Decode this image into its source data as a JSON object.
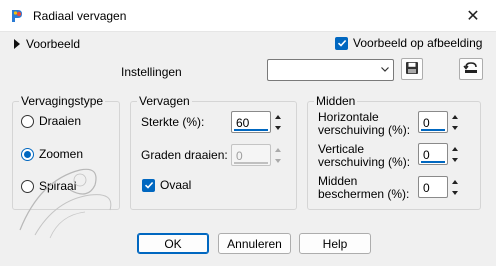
{
  "window": {
    "title": "Radiaal vervagen",
    "close_glyph": "✕"
  },
  "preview": {
    "label": "Voorbeeld",
    "on_image_label": "Voorbeeld op afbeelding",
    "on_image_checked": true
  },
  "settings": {
    "label": "Instellingen",
    "value": ""
  },
  "blur_type": {
    "title": "Vervagingstype",
    "options": [
      {
        "label": "Draaien",
        "selected": false
      },
      {
        "label": "Zoomen",
        "selected": true
      },
      {
        "label": "Spiraal",
        "selected": false
      }
    ]
  },
  "blur": {
    "title": "Vervagen",
    "strength_label": "Sterkte (%):",
    "strength_value": "60",
    "twist_label": "Graden draaien:",
    "twist_value": "0",
    "twist_enabled": false,
    "oval_label": "Ovaal",
    "oval_checked": true
  },
  "center": {
    "title": "Midden",
    "h_offset_label_1": "Horizontale",
    "h_offset_label_2": "verschuiving (%):",
    "h_offset_value": "0",
    "v_offset_label_1": "Verticale",
    "v_offset_label_2": "verschuiving (%):",
    "v_offset_value": "0",
    "protect_label_1": "Midden",
    "protect_label_2": "beschermen (%):",
    "protect_value": "0"
  },
  "buttons": {
    "ok": "OK",
    "cancel": "Annuleren",
    "help": "Help"
  },
  "colors": {
    "accent": "#0067c0",
    "background": "#f0f0f0"
  },
  "icons": [
    "app-icon",
    "close-icon",
    "expand-triangle-icon",
    "checkbox-check-icon",
    "dropdown-chevron-icon",
    "save-floppy-icon",
    "reset-defaults-icon"
  ]
}
